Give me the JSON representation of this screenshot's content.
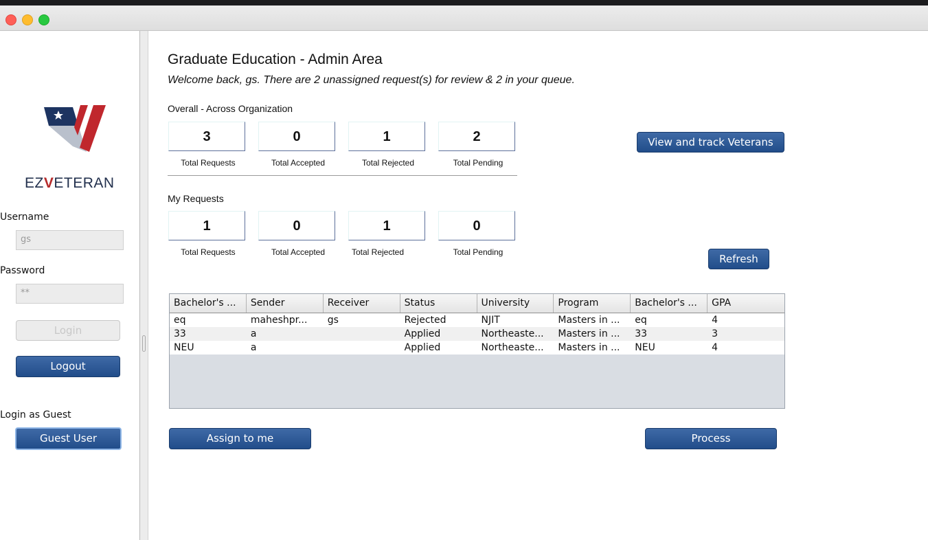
{
  "sidebar": {
    "brand": {
      "prefix": "EZ",
      "suffix": "ETERAN"
    },
    "username_label": "Username",
    "username_value": "gs",
    "password_label": "Password",
    "password_value": "**",
    "login_label": "Login",
    "logout_label": "Logout",
    "guest_heading": "Login as Guest",
    "guest_button": "Guest User"
  },
  "main": {
    "title": "Graduate Education - Admin Area",
    "welcome": "Welcome back, gs. There are 2 unassigned request(s) for review & 2 in your queue.",
    "overall_label": "Overall - Across Organization",
    "overall": [
      {
        "value": "3",
        "label": "Total Requests"
      },
      {
        "value": "0",
        "label": "Total Accepted"
      },
      {
        "value": "1",
        "label": "Total Rejected"
      },
      {
        "value": "2",
        "label": "Total Pending"
      }
    ],
    "my_label": "My Requests",
    "mine": [
      {
        "value": "1",
        "label": "Total Requests"
      },
      {
        "value": "0",
        "label": "Total Accepted"
      },
      {
        "value": "1",
        "label": "Total Rejected"
      },
      {
        "value": "0",
        "label": "Total Pending"
      }
    ],
    "view_track_button": "View and track Veterans",
    "refresh_button": "Refresh",
    "assign_button": "Assign to me",
    "process_button": "Process"
  },
  "table": {
    "columns": [
      "Bachelor's ...",
      "Sender",
      "Receiver",
      "Status",
      "University",
      "Program",
      "Bachelor's ...",
      "GPA"
    ],
    "rows": [
      [
        "eq",
        "maheshpr...",
        "gs",
        "Rejected",
        "NJIT",
        "Masters in ...",
        "eq",
        "4"
      ],
      [
        "33",
        "a",
        "",
        "Applied",
        "Northeaste...",
        "Masters in ...",
        "33",
        "3"
      ],
      [
        "NEU",
        "a",
        "",
        "Applied",
        "Northeaste...",
        "Masters in ...",
        "NEU",
        "4"
      ]
    ]
  },
  "colors": {
    "button_blue": "#2a5592",
    "flag_blue": "#1d3461",
    "flag_red": "#c0272d"
  }
}
